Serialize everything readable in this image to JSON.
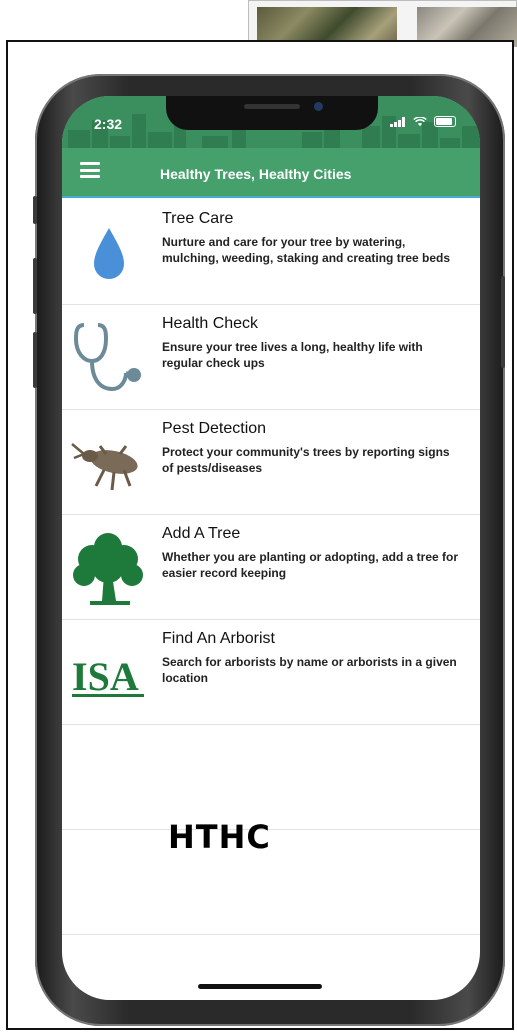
{
  "status_bar": {
    "time": "2:32"
  },
  "app": {
    "title": "Healthy Trees, Healthy Cities"
  },
  "menu": [
    {
      "title": "Tree Care",
      "description": "Nurture and care for your tree by watering, mulching, weeding, staking and creating tree beds",
      "icon": "water-drop-icon"
    },
    {
      "title": "Health Check",
      "description": "Ensure your tree lives a long, healthy life with regular check ups",
      "icon": "stethoscope-icon"
    },
    {
      "title": "Pest Detection",
      "description": "Protect your community's trees by reporting signs of pests/diseases",
      "icon": "beetle-icon"
    },
    {
      "title": "Add A Tree",
      "description": "Whether you are planting or adopting, add a tree for easier record keeping",
      "icon": "tree-icon"
    },
    {
      "title": "Find An Arborist",
      "description": "Search for arborists by name or arborists in a given location",
      "icon": "isa-logo-icon"
    }
  ],
  "isa_logo_text": "ISA",
  "caption": "HTHC",
  "colors": {
    "header": "#3b8f5f",
    "accent_line": "#49a9d0",
    "drop": "#4a90d9",
    "tree": "#1e7a3a"
  }
}
